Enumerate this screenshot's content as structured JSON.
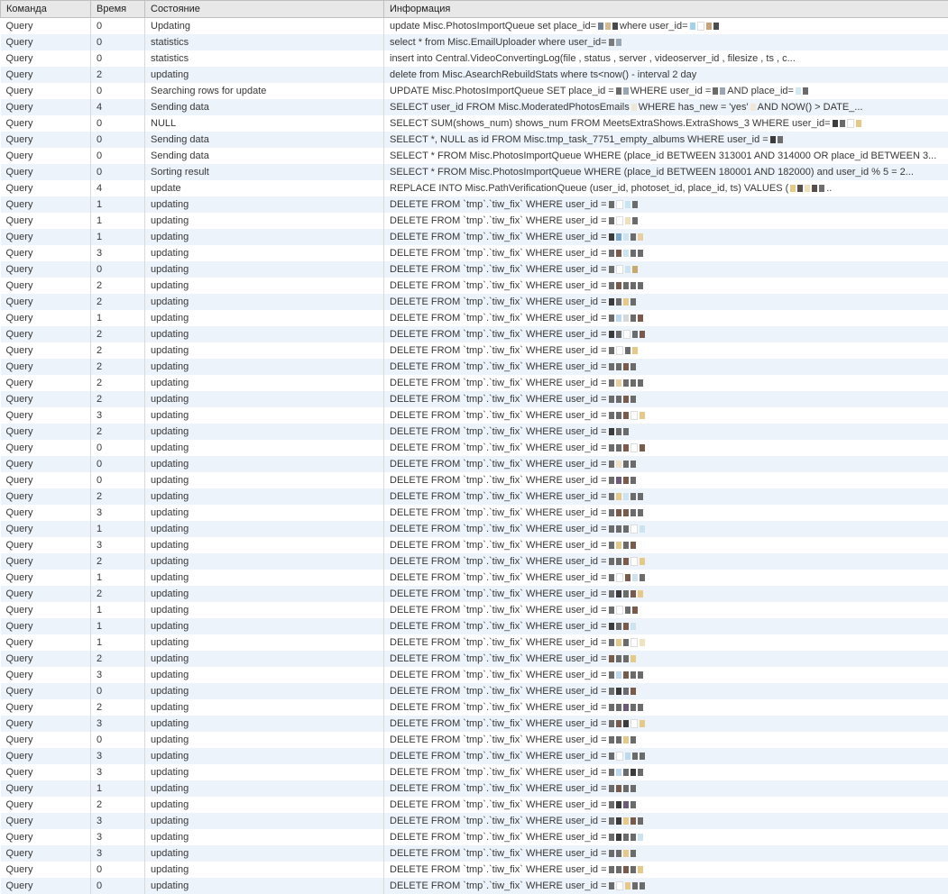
{
  "headers": {
    "command": "Команда",
    "time": "Время",
    "state": "Состояние",
    "info": "Информация"
  },
  "rows": [
    {
      "cmd": "Query",
      "time": "0",
      "state": "Updating",
      "info_pre": "update Misc.PhotosImportQueue set place_id=",
      "cens1": [
        "#708090",
        "#d7b98e",
        "#4a4a4a"
      ],
      "info_mid": " where user_id=",
      "cens2": [
        "#9fd3ef",
        "#ffffff",
        "#caa27a",
        "#4d4d4d"
      ],
      "info_post": ""
    },
    {
      "cmd": "Query",
      "time": "0",
      "state": "statistics",
      "info_pre": "select * from Misc.EmailUploader where user_id=   ",
      "cens1": [
        "#7a7a7a",
        "#9aa6b3"
      ],
      "info_mid": "",
      "cens2": [],
      "info_post": ""
    },
    {
      "cmd": "Query",
      "time": "0",
      "state": "statistics",
      "info_pre": "insert into Central.VideoConvertingLog(file , status , server , videoserver_id ,  filesize ,  ts , c...",
      "cens1": [],
      "info_mid": "",
      "cens2": [],
      "info_post": ""
    },
    {
      "cmd": "Query",
      "time": "2",
      "state": "updating",
      "info_pre": "delete from Misc.AsearchRebuildStats where ts<now() - interval 2 day",
      "cens1": [],
      "info_mid": "",
      "cens2": [],
      "info_post": ""
    },
    {
      "cmd": "Query",
      "time": "0",
      "state": "Searching rows for update",
      "info_pre": "UPDATE Misc.PhotosImportQueue SET place_id = ",
      "cens1": [
        "#6b6b6b",
        "#9aa6b3"
      ],
      "info_mid": " WHERE user_id = ",
      "cens2": [
        "#6b6b6b",
        "#9aa6b3"
      ],
      "info_post": "     AND place_id=",
      "cens3": [
        "#d3e8f5",
        "#6b6b6b"
      ]
    },
    {
      "cmd": "Query",
      "time": "4",
      "state": "Sending data",
      "info_pre": "SELECT user_id FROM Misc.ModeratedPhotosEmails ",
      "cens1": [
        "#efe7d7"
      ],
      "info_mid": "   WHERE has_new = 'yes'",
      "cens2": [
        "#efe7d7"
      ],
      "info_post": "      AND NOW() > DATE_..."
    },
    {
      "cmd": "Query",
      "time": "0",
      "state": "NULL",
      "info_pre": "SELECT SUM(shows_num) shows_num FROM MeetsExtraShows.ExtraShows_3 WHERE user_id=",
      "cens1": [
        "#3d3d3d",
        "#6b6b6b",
        "#ffffff",
        "#e6c986"
      ],
      "info_mid": "",
      "cens2": [],
      "info_post": ""
    },
    {
      "cmd": "Query",
      "time": "0",
      "state": "Sending data",
      "info_pre": "SELECT *, NULL as id FROM Misc.tmp_task_7751_empty_albums WHERE user_id = ",
      "cens1": [
        "#3b3b3b",
        "#6e6e6e"
      ],
      "info_mid": "",
      "cens2": [],
      "info_post": ""
    },
    {
      "cmd": "Query",
      "time": "0",
      "state": "Sending data",
      "info_pre": "SELECT * FROM Misc.PhotosImportQueue WHERE (place_id BETWEEN 313001 AND 314000 OR place_id BETWEEN 3...",
      "cens1": [],
      "info_mid": "",
      "cens2": [],
      "info_post": ""
    },
    {
      "cmd": "Query",
      "time": "0",
      "state": "Sorting result",
      "info_pre": "SELECT * FROM Misc.PhotosImportQueue WHERE (place_id BETWEEN 180001 AND 182000)  and user_id % 5 = 2...",
      "cens1": [],
      "info_mid": "",
      "cens2": [],
      "info_post": ""
    },
    {
      "cmd": "Query",
      "time": "4",
      "state": "update",
      "info_pre": "REPLACE INTO Misc.PathVerificationQueue (user_id, photoset_id, place_id, ts) VALUES (  ",
      "cens1": [
        "#e6c986",
        "#5a4f4a",
        "#efe0bc",
        "#5a4f4a",
        "#6e6e6e"
      ],
      "info_mid": " ..",
      "cens2": [],
      "info_post": ""
    },
    {
      "cmd": "Query",
      "time": "1",
      "state": "updating",
      "info_pre": "DELETE FROM `tmp`.`tiw_fix` WHERE user_id = ",
      "cens1": [
        "#6b6b6b",
        "#ffffff",
        "#c7e4f3",
        "#6b6b6b"
      ],
      "info_mid": "",
      "cens2": [],
      "info_post": ""
    },
    {
      "cmd": "Query",
      "time": "1",
      "state": "updating",
      "info_pre": "DELETE FROM `tmp`.`tiw_fix` WHERE user_id = ",
      "cens1": [
        "#6b6b6b",
        "#ffffff",
        "#efe0bc",
        "#6b6b6b"
      ],
      "info_mid": "",
      "cens2": [],
      "info_post": ""
    },
    {
      "cmd": "Query",
      "time": "1",
      "state": "updating",
      "info_pre": "DELETE FROM `tmp`.`tiw_fix` WHERE user_id = ",
      "cens1": [
        "#3b3b3b",
        "#7aa6c9",
        "#cde3f0",
        "#6b6b6b",
        "#e9cf9e"
      ],
      "info_mid": "",
      "cens2": [],
      "info_post": ""
    },
    {
      "cmd": "Query",
      "time": "3",
      "state": "updating",
      "info_pre": "DELETE FROM `tmp`.`tiw_fix` WHERE user_id = ",
      "cens1": [
        "#6b6b6b",
        "#7a5a4a",
        "#cde3f0",
        "#6b6b6b",
        "#6b6b6b"
      ],
      "info_mid": "",
      "cens2": [],
      "info_post": ""
    },
    {
      "cmd": "Query",
      "time": "0",
      "state": "updating",
      "info_pre": "DELETE FROM `tmp`.`tiw_fix` WHERE user_id = ",
      "cens1": [
        "#6b6b6b",
        "#ffffff",
        "#cde3f0",
        "#c7a96e"
      ],
      "info_mid": "",
      "cens2": [],
      "info_post": ""
    },
    {
      "cmd": "Query",
      "time": "2",
      "state": "updating",
      "info_pre": "DELETE FROM `tmp`.`tiw_fix` WHERE user_id = ",
      "cens1": [
        "#6b6b6b",
        "#7a5a4a",
        "#6b6b6b",
        "#6b6b6b",
        "#6b6b6b"
      ],
      "info_mid": "",
      "cens2": [],
      "info_post": ""
    },
    {
      "cmd": "Query",
      "time": "2",
      "state": "updating",
      "info_pre": "DELETE FROM `tmp`.`tiw_fix` WHERE user_id = ",
      "cens1": [
        "#3b3b3b",
        "#6b6b6b",
        "#e6c986",
        "#6b6b6b"
      ],
      "info_mid": "",
      "cens2": [],
      "info_post": ""
    },
    {
      "cmd": "Query",
      "time": "1",
      "state": "updating",
      "info_pre": "DELETE FROM `tmp`.`tiw_fix` WHERE user_id = ",
      "cens1": [
        "#6b6b6b",
        "#bcd9ef",
        "#d7d7d7",
        "#6b6b6b",
        "#7a5a4a"
      ],
      "info_mid": "",
      "cens2": [],
      "info_post": ""
    },
    {
      "cmd": "Query",
      "time": "2",
      "state": "updating",
      "info_pre": "DELETE FROM `tmp`.`tiw_fix` WHERE user_id = ",
      "cens1": [
        "#3b3b3b",
        "#6b6b6b",
        "#ffffff",
        "#6b6b6b",
        "#7a5a4a"
      ],
      "info_mid": "",
      "cens2": [],
      "info_post": ""
    },
    {
      "cmd": "Query",
      "time": "2",
      "state": "updating",
      "info_pre": "DELETE FROM `tmp`.`tiw_fix` WHERE user_id = ",
      "cens1": [
        "#6b6b6b",
        "#ffffff",
        "#6b6b6b",
        "#e6c986"
      ],
      "info_mid": "",
      "cens2": [],
      "info_post": ""
    },
    {
      "cmd": "Query",
      "time": "2",
      "state": "updating",
      "info_pre": "DELETE FROM `tmp`.`tiw_fix` WHERE user_id = ",
      "cens1": [
        "#6b6b6b",
        "#6b6b6b",
        "#7a5a4a",
        "#6b6b6b"
      ],
      "info_mid": "",
      "cens2": [],
      "info_post": ""
    },
    {
      "cmd": "Query",
      "time": "2",
      "state": "updating",
      "info_pre": "DELETE FROM `tmp`.`tiw_fix` WHERE user_id = ",
      "cens1": [
        "#6b6b6b",
        "#e9cf9e",
        "#6b6b6b",
        "#6b6b6b",
        "#6b6b6b"
      ],
      "info_mid": "",
      "cens2": [],
      "info_post": ""
    },
    {
      "cmd": "Query",
      "time": "2",
      "state": "updating",
      "info_pre": "DELETE FROM `tmp`.`tiw_fix` WHERE user_id = ",
      "cens1": [
        "#6b6b6b",
        "#6b6b6b",
        "#7a5a4a",
        "#6b6b6b"
      ],
      "info_mid": "",
      "cens2": [],
      "info_post": ""
    },
    {
      "cmd": "Query",
      "time": "3",
      "state": "updating",
      "info_pre": "DELETE FROM `tmp`.`tiw_fix` WHERE user_id = ",
      "cens1": [
        "#6b6b6b",
        "#6b6b6b",
        "#7a5a4a",
        "#ffffff",
        "#e6c986"
      ],
      "info_mid": "",
      "cens2": [],
      "info_post": ""
    },
    {
      "cmd": "Query",
      "time": "2",
      "state": "updating",
      "info_pre": "DELETE FROM `tmp`.`tiw_fix` WHERE user_id = ",
      "cens1": [
        "#3b3b3b",
        "#6b6b6b",
        "#6b6b6b"
      ],
      "info_mid": "",
      "cens2": [],
      "info_post": ""
    },
    {
      "cmd": "Query",
      "time": "0",
      "state": "updating",
      "info_pre": "DELETE FROM `tmp`.`tiw_fix` WHERE user_id = ",
      "cens1": [
        "#6b6b6b",
        "#6b6b6b",
        "#7a5a4a",
        "#ffffff",
        "#7a5a4a"
      ],
      "info_mid": "",
      "cens2": [],
      "info_post": ""
    },
    {
      "cmd": "Query",
      "time": "0",
      "state": "updating",
      "info_pre": "DELETE FROM `tmp`.`tiw_fix` WHERE user_id = ",
      "cens1": [
        "#6b6b6b",
        "#f0e2c0",
        "#6b6b6b",
        "#6b6b6b"
      ],
      "info_mid": "",
      "cens2": [],
      "info_post": ""
    },
    {
      "cmd": "Query",
      "time": "0",
      "state": "updating",
      "info_pre": "DELETE FROM `tmp`.`tiw_fix` WHERE user_id = ",
      "cens1": [
        "#6b6b6b",
        "#6e5a7a",
        "#7a5a4a",
        "#6b6b6b"
      ],
      "info_mid": "",
      "cens2": [],
      "info_post": ""
    },
    {
      "cmd": "Query",
      "time": "2",
      "state": "updating",
      "info_pre": "DELETE FROM `tmp`.`tiw_fix` WHERE user_id = ",
      "cens1": [
        "#6b6b6b",
        "#e6c986",
        "#cde3f0",
        "#6b6b6b",
        "#6b6b6b"
      ],
      "info_mid": "",
      "cens2": [],
      "info_post": ""
    },
    {
      "cmd": "Query",
      "time": "3",
      "state": "updating",
      "info_pre": "DELETE FROM `tmp`.`tiw_fix` WHERE user_id = ",
      "cens1": [
        "#6b6b6b",
        "#7a5a4a",
        "#7a5a4a",
        "#6b6b6b",
        "#6b6b6b"
      ],
      "info_mid": "",
      "cens2": [],
      "info_post": ""
    },
    {
      "cmd": "Query",
      "time": "1",
      "state": "updating",
      "info_pre": "DELETE FROM `tmp`.`tiw_fix` WHERE user_id = ",
      "cens1": [
        "#6b6b6b",
        "#6b6b6b",
        "#6b6b6b",
        "#ffffff",
        "#cde3f0"
      ],
      "info_mid": "",
      "cens2": [],
      "info_post": ""
    },
    {
      "cmd": "Query",
      "time": "3",
      "state": "updating",
      "info_pre": "DELETE FROM `tmp`.`tiw_fix` WHERE user_id = ",
      "cens1": [
        "#6b6b6b",
        "#e6c986",
        "#6b6b6b",
        "#7a5a4a"
      ],
      "info_mid": "",
      "cens2": [],
      "info_post": ""
    },
    {
      "cmd": "Query",
      "time": "2",
      "state": "updating",
      "info_pre": "DELETE FROM `tmp`.`tiw_fix` WHERE user_id = ",
      "cens1": [
        "#6b6b6b",
        "#6b6b6b",
        "#7a5a4a",
        "#ffffff",
        "#e6c986"
      ],
      "info_mid": "",
      "cens2": [],
      "info_post": ""
    },
    {
      "cmd": "Query",
      "time": "1",
      "state": "updating",
      "info_pre": "DELETE FROM `tmp`.`tiw_fix` WHERE user_id = ",
      "cens1": [
        "#6b6b6b",
        "#ffffff",
        "#7a5a4a",
        "#cde3f0",
        "#6b6b6b"
      ],
      "info_mid": "",
      "cens2": [],
      "info_post": ""
    },
    {
      "cmd": "Query",
      "time": "2",
      "state": "updating",
      "info_pre": "DELETE FROM `tmp`.`tiw_fix` WHERE user_id = ",
      "cens1": [
        "#6b6b6b",
        "#3b3b3b",
        "#6b6b6b",
        "#7a5a4a",
        "#e6c986"
      ],
      "info_mid": "",
      "cens2": [],
      "info_post": ""
    },
    {
      "cmd": "Query",
      "time": "1",
      "state": "updating",
      "info_pre": "DELETE FROM `tmp`.`tiw_fix` WHERE user_id = ",
      "cens1": [
        "#6b6b6b",
        "#ffffff",
        "#6b6b6b",
        "#7a5a4a"
      ],
      "info_mid": "",
      "cens2": [],
      "info_post": ""
    },
    {
      "cmd": "Query",
      "time": "1",
      "state": "updating",
      "info_pre": "DELETE FROM `tmp`.`tiw_fix` WHERE user_id = ",
      "cens1": [
        "#3b3b3b",
        "#6b6b6b",
        "#7a5a4a",
        "#cde3f0"
      ],
      "info_mid": "",
      "cens2": [],
      "info_post": ""
    },
    {
      "cmd": "Query",
      "time": "1",
      "state": "updating",
      "info_pre": "DELETE FROM `tmp`.`tiw_fix` WHERE user_id = ",
      "cens1": [
        "#6b6b6b",
        "#e6c986",
        "#6b6b6b",
        "#ffffff",
        "#f0e2c0"
      ],
      "info_mid": "",
      "cens2": [],
      "info_post": ""
    },
    {
      "cmd": "Query",
      "time": "2",
      "state": "updating",
      "info_pre": "DELETE FROM `tmp`.`tiw_fix` WHERE user_id =   ",
      "cens1": [
        "#7a5a4a",
        "#6b6b6b",
        "#6b6b6b",
        "#e6c986"
      ],
      "info_mid": "",
      "cens2": [],
      "info_post": ""
    },
    {
      "cmd": "Query",
      "time": "3",
      "state": "updating",
      "info_pre": "DELETE FROM `tmp`.`tiw_fix` WHERE user_id = ",
      "cens1": [
        "#6b6b6b",
        "#bcd9ef",
        "#7a5a4a",
        "#6b6b6b",
        "#6b6b6b"
      ],
      "info_mid": "",
      "cens2": [],
      "info_post": ""
    },
    {
      "cmd": "Query",
      "time": "0",
      "state": "updating",
      "info_pre": "DELETE FROM `tmp`.`tiw_fix` WHERE user_id = ",
      "cens1": [
        "#6b6b6b",
        "#3b3b3b",
        "#6b6b6b",
        "#7a5a4a"
      ],
      "info_mid": "",
      "cens2": [],
      "info_post": ""
    },
    {
      "cmd": "Query",
      "time": "2",
      "state": "updating",
      "info_pre": "DELETE FROM `tmp`.`tiw_fix` WHERE user_id = ",
      "cens1": [
        "#6b6b6b",
        "#6b6b6b",
        "#6e5a7a",
        "#6b6b6b",
        "#6b6b6b"
      ],
      "info_mid": "",
      "cens2": [],
      "info_post": ""
    },
    {
      "cmd": "Query",
      "time": "3",
      "state": "updating",
      "info_pre": "DELETE FROM `tmp`.`tiw_fix` WHERE user_id = ",
      "cens1": [
        "#6b6b6b",
        "#7a5a4a",
        "#3b3b3b",
        "#ffffff",
        "#e6c986"
      ],
      "info_mid": "",
      "cens2": [],
      "info_post": ""
    },
    {
      "cmd": "Query",
      "time": "0",
      "state": "updating",
      "info_pre": "DELETE FROM `tmp`.`tiw_fix` WHERE user_id = ",
      "cens1": [
        "#6b6b6b",
        "#6b6b6b",
        "#e6c986",
        "#6b6b6b"
      ],
      "info_mid": "",
      "cens2": [],
      "info_post": ""
    },
    {
      "cmd": "Query",
      "time": "3",
      "state": "updating",
      "info_pre": "DELETE FROM `tmp`.`tiw_fix` WHERE user_id = ",
      "cens1": [
        "#6b6b6b",
        "#ffffff",
        "#bcd9ef",
        "#6b6b6b",
        "#6b6b6b"
      ],
      "info_mid": "",
      "cens2": [],
      "info_post": ""
    },
    {
      "cmd": "Query",
      "time": "3",
      "state": "updating",
      "info_pre": "DELETE FROM `tmp`.`tiw_fix` WHERE user_id = ",
      "cens1": [
        "#6b6b6b",
        "#bcd9ef",
        "#6b6b6b",
        "#3b3b3b",
        "#6b6b6b"
      ],
      "info_mid": "",
      "cens2": [],
      "info_post": ""
    },
    {
      "cmd": "Query",
      "time": "1",
      "state": "updating",
      "info_pre": "DELETE FROM `tmp`.`tiw_fix` WHERE user_id = ",
      "cens1": [
        "#6b6b6b",
        "#7a5a4a",
        "#6b6b6b",
        "#6b6b6b"
      ],
      "info_mid": "",
      "cens2": [],
      "info_post": ""
    },
    {
      "cmd": "Query",
      "time": "2",
      "state": "updating",
      "info_pre": "DELETE FROM `tmp`.`tiw_fix` WHERE user_id = ",
      "cens1": [
        "#6b6b6b",
        "#3b3b3b",
        "#6e5a7a",
        "#6b6b6b"
      ],
      "info_mid": "",
      "cens2": [],
      "info_post": ""
    },
    {
      "cmd": "Query",
      "time": "3",
      "state": "updating",
      "info_pre": "DELETE FROM `tmp`.`tiw_fix` WHERE user_id = ",
      "cens1": [
        "#6b6b6b",
        "#3b3b3b",
        "#e6c986",
        "#7a5a4a",
        "#6b6b6b"
      ],
      "info_mid": "",
      "cens2": [],
      "info_post": ""
    },
    {
      "cmd": "Query",
      "time": "3",
      "state": "updating",
      "info_pre": "DELETE FROM `tmp`.`tiw_fix` WHERE user_id = ",
      "cens1": [
        "#6b6b6b",
        "#3b3b3b",
        "#6b6b6b",
        "#6b6b6b",
        "#cde3f0"
      ],
      "info_mid": "",
      "cens2": [],
      "info_post": ""
    },
    {
      "cmd": "Query",
      "time": "3",
      "state": "updating",
      "info_pre": "DELETE FROM `tmp`.`tiw_fix` WHERE user_id = ",
      "cens1": [
        "#6b6b6b",
        "#6b6b6b",
        "#e6c986",
        "#6b6b6b"
      ],
      "info_mid": "",
      "cens2": [],
      "info_post": ""
    },
    {
      "cmd": "Query",
      "time": "0",
      "state": "updating",
      "info_pre": "DELETE FROM `tmp`.`tiw_fix` WHERE user_id = ",
      "cens1": [
        "#6b6b6b",
        "#6b6b6b",
        "#7a5a4a",
        "#6b6b6b",
        "#e6c986"
      ],
      "info_mid": "",
      "cens2": [],
      "info_post": ""
    },
    {
      "cmd": "Query",
      "time": "0",
      "state": "updating",
      "info_pre": "DELETE FROM `tmp`.`tiw_fix` WHERE user_id = ",
      "cens1": [
        "#6b6b6b",
        "#ffffff",
        "#e6c986",
        "#6b6b6b",
        "#6b6b6b"
      ],
      "info_mid": "",
      "cens2": [],
      "info_post": ""
    }
  ]
}
